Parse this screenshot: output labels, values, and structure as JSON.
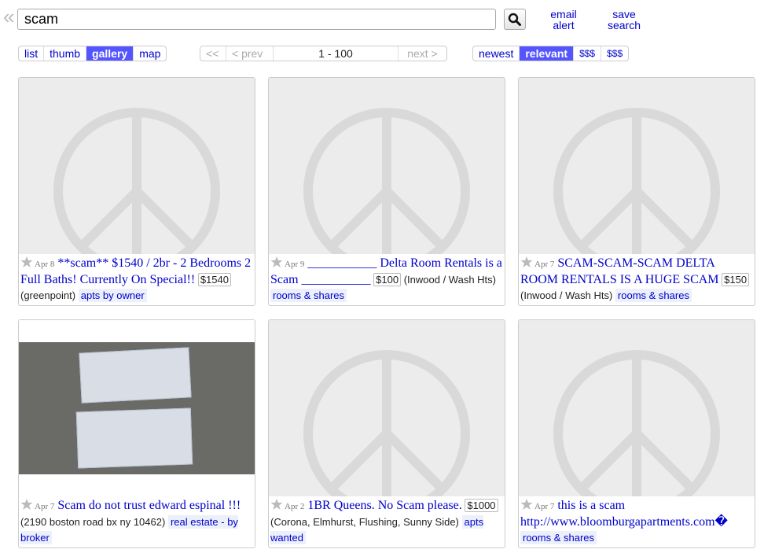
{
  "search": {
    "value": "scam"
  },
  "header": {
    "email_alert": [
      "email",
      "alert"
    ],
    "save_search": [
      "save",
      "search"
    ]
  },
  "view_modes": [
    "list",
    "thumb",
    "gallery",
    "map"
  ],
  "active_view": "gallery",
  "pager": {
    "first": "<<",
    "prev": "< prev",
    "range": "1 - 100",
    "next": "next >"
  },
  "sort": [
    "newest",
    "relevant",
    "$$$",
    "$$$"
  ],
  "active_sort": "relevant",
  "listings": [
    {
      "date": "Apr 8",
      "title": "**scam** $1540 / 2br - 2 Bedrooms 2 Full Baths! Currently On Special!!",
      "price": "$1540",
      "location": "(greenpoint)",
      "category": "apts by owner",
      "image": "placeholder"
    },
    {
      "date": "Apr 9",
      "title": "___________ Delta Room Rentals is a Scam ___________",
      "price": "$100",
      "location": "(Inwood / Wash Hts)",
      "category": "rooms & shares",
      "image": "placeholder"
    },
    {
      "date": "Apr 7",
      "title": "SCAM-SCAM-SCAM DELTA ROOM RENTALS IS A HUGE SCAM",
      "price": "$150",
      "location": "(Inwood / Wash Hts)",
      "category": "rooms & shares",
      "image": "placeholder"
    },
    {
      "date": "Apr 7",
      "title": "Scam do not trust edward espinal !!!",
      "price": "",
      "location": "(2190 boston road bx ny 10462)",
      "category": "real estate - by broker",
      "image": "receipt-photo"
    },
    {
      "date": "Apr 2",
      "title": "1BR Queens. No Scam please.",
      "price": "$1000",
      "location": "(Corona, Elmhurst, Flushing, Sunny Side)",
      "category": "apts wanted",
      "image": "placeholder"
    },
    {
      "date": "Apr 7",
      "title": "this is a scam http://www.bloomburgapartments.com�",
      "price": "",
      "location": "",
      "category": "rooms & shares",
      "image": "placeholder"
    }
  ],
  "icons": {
    "back": "double-chevron-left-icon",
    "search": "magnifier-icon",
    "favorite": "star-icon",
    "placeholder": "peace-sign-icon"
  },
  "colors": {
    "link": "#0000cc",
    "active": "#5555ff",
    "placeholder_bg": "#ececec",
    "category_bg": "#ebf0fa"
  }
}
